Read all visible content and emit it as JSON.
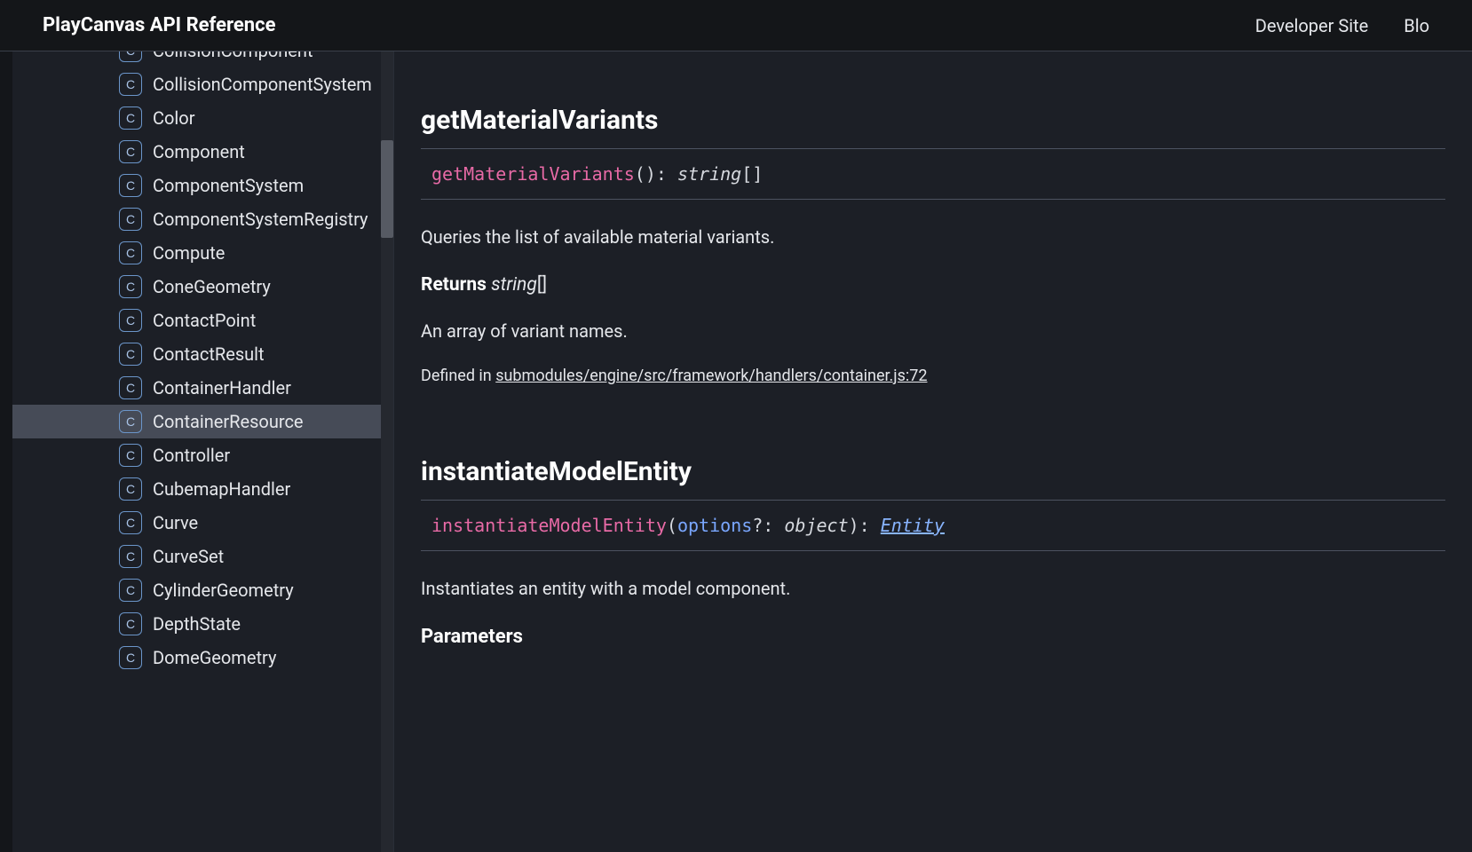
{
  "header": {
    "title": "PlayCanvas API Reference",
    "links": [
      "Developer Site",
      "Blo"
    ]
  },
  "sidebar": {
    "badge_letter": "C",
    "items": [
      "CollisionComponent",
      "CollisionComponentSystem",
      "Color",
      "Component",
      "ComponentSystem",
      "ComponentSystemRegistry",
      "Compute",
      "ConeGeometry",
      "ContactPoint",
      "ContactResult",
      "ContainerHandler",
      "ContainerResource",
      "Controller",
      "CubemapHandler",
      "Curve",
      "CurveSet",
      "CylinderGeometry",
      "DepthState",
      "DomeGeometry"
    ],
    "selected_index": 11
  },
  "content": {
    "method1": {
      "title": "getMaterialVariants",
      "sig": {
        "fn": "getMaterialVariants",
        "after_fn": "()",
        "colon": ": ",
        "ret_type": "string",
        "ret_suffix": "[]"
      },
      "description": "Queries the list of available material variants.",
      "returns_label": "Returns",
      "returns_type": "string",
      "returns_suffix": "[]",
      "returns_desc": "An array of variant names.",
      "defined_prefix": "Defined in ",
      "defined_link": "submodules/engine/src/framework/handlers/container.js:72"
    },
    "method2": {
      "title": "instantiateModelEntity",
      "sig": {
        "fn": "instantiateModelEntity",
        "open": "(",
        "param": "options",
        "opt": "?: ",
        "ptype": "object",
        "close": ")",
        "colon": ": ",
        "ret_link": "Entity"
      },
      "description": "Instantiates an entity with a model component.",
      "params_heading": "Parameters"
    }
  }
}
